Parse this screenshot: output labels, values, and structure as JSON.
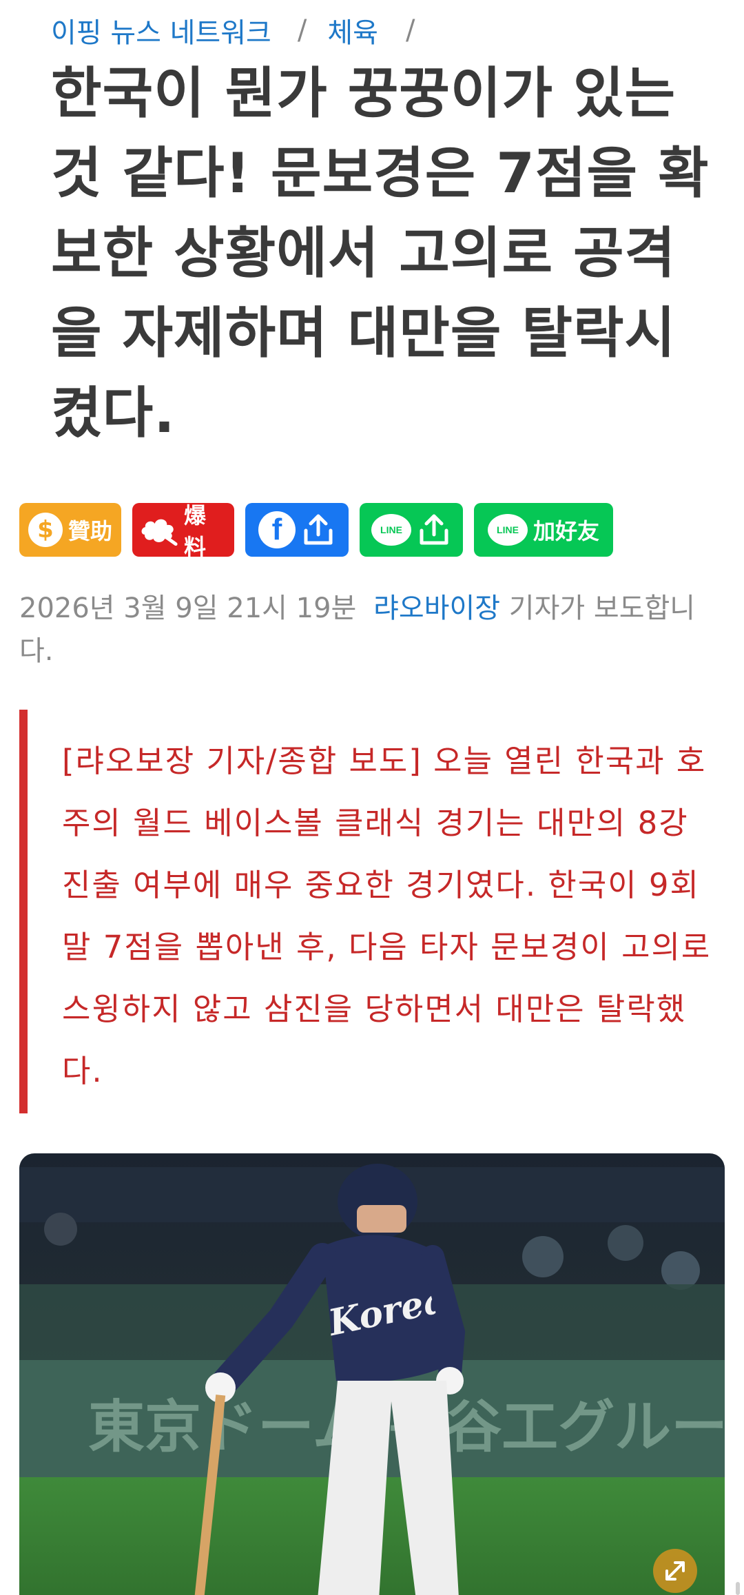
{
  "breadcrumb": {
    "site": "이핑 뉴스 네트워크",
    "sep1": "/",
    "category": "체육",
    "sep2": "/"
  },
  "article": {
    "title": "한국이 뭔가 꿍꿍이가 있는 것 같다! 문보경은 7점을 확보한 상황에서 고의로 공격을 자제하며 대만을 탈락시켰다.",
    "date": "2026년 3월 9일 21시 19분",
    "author": "랴오바이장",
    "byline_suffix": "기자가 보도합니다.",
    "lead": "[랴오보장 기자/종합 보도] 오늘 열린 한국과 호주의 월드 베이스볼 클래식 경기는 대만의 8강 진출 여부에 매우 중요한 경기였다. 한국이 9회말 7점을 뽑아낸 후, 다음 타자 문보경이 고의로 스윙하지 않고 삼진을 당하면서 대만은 탈락했다."
  },
  "share_buttons": {
    "tip_label": "贊助",
    "report_label": "爆料",
    "line_friend_label": "加好友",
    "line_logo_text": "LINE",
    "coin_symbol": "$",
    "fb_symbol": "f"
  },
  "photo": {
    "jersey_text": "Korea",
    "stadium_sign": "東京ドーム 長谷工グループ"
  },
  "icons": {
    "coin": "dollar-coin-icon",
    "report": "cloud-burst-icon",
    "facebook": "facebook-icon",
    "share": "share-upload-icon",
    "line": "line-icon",
    "expand": "expand-icon"
  },
  "colors": {
    "link_blue": "#1e78c8",
    "quote_red": "#c62828",
    "tip_orange": "#f5a623",
    "report_red": "#e01e1e",
    "facebook_blue": "#1877f2",
    "line_green": "#06c755"
  }
}
